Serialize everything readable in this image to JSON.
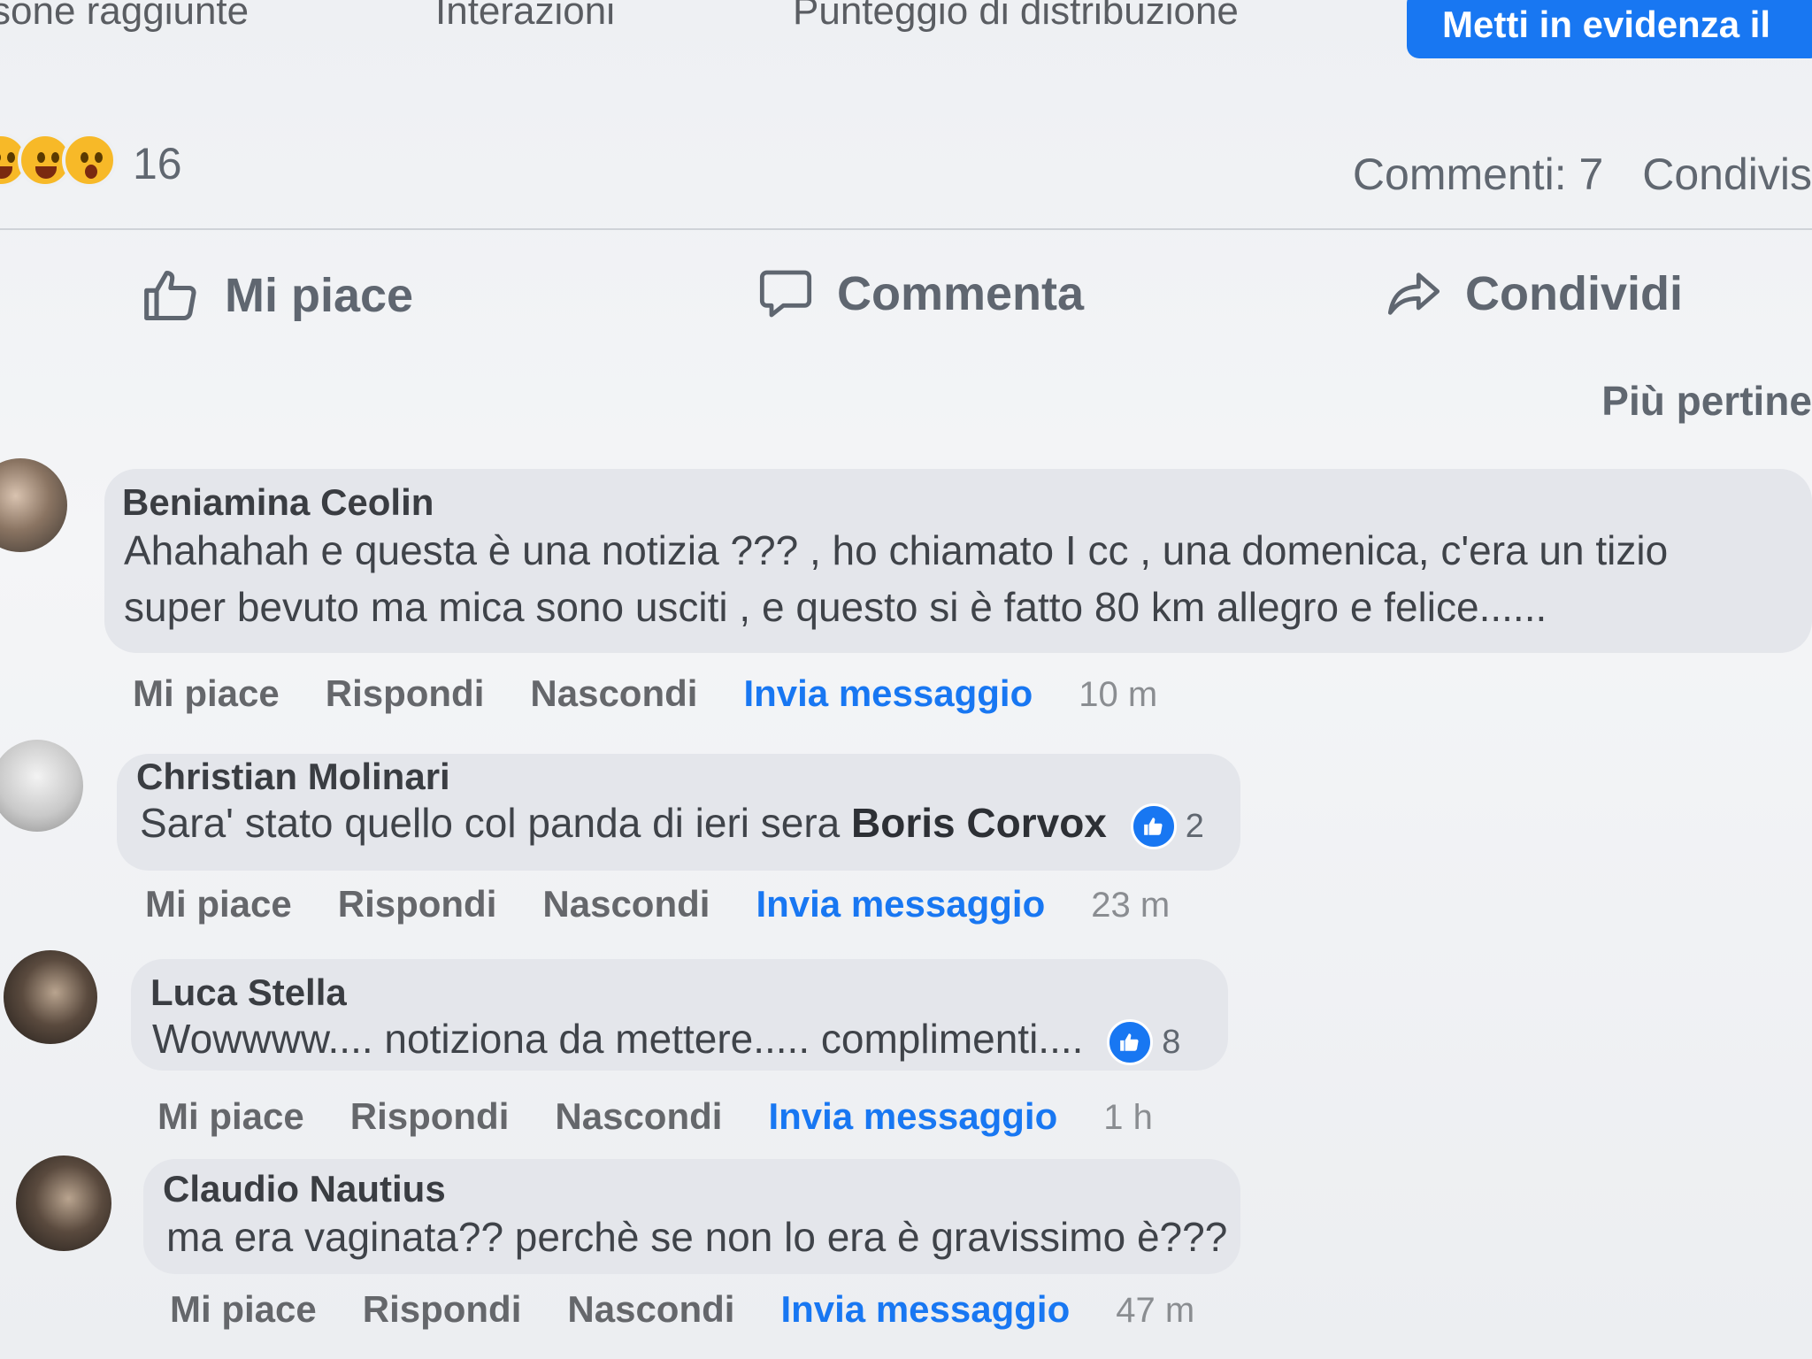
{
  "insights": {
    "reach_label": "sone raggiunte",
    "interactions_label": "Interazioni",
    "distribution_label": "Punteggio di distribuzione",
    "boost_button": "Metti in evidenza il"
  },
  "stats": {
    "reaction_count": "16",
    "comments": "Commenti: 7",
    "shares": "Condivis"
  },
  "actions": {
    "like": "Mi piace",
    "comment": "Commenta",
    "share": "Condividi"
  },
  "sort_label": "Più pertine",
  "comment_actions": {
    "like": "Mi piace",
    "reply": "Rispondi",
    "hide": "Nascondi",
    "message": "Invia messaggio"
  },
  "comments": [
    {
      "author": "Beniamina Ceolin",
      "line1": "Ahahahah e questa è una notizia ??? , ho chiamato I cc , una domenica, c'era un tizio",
      "line2": "super bevuto ma mica sono usciti , e questo si è fatto 80 km allegro e felice......",
      "time": "10 m"
    },
    {
      "author": "Christian Molinari",
      "text": "Sara' stato quello col panda di ieri sera",
      "mention": "Boris Corvox",
      "likes": "2",
      "time": "23 m"
    },
    {
      "author": "Luca Stella",
      "text": "Wowwww.... notiziona da mettere..... complimenti....",
      "likes": "8",
      "time": "1 h"
    },
    {
      "author": "Claudio Nautius",
      "text": "ma era vaginata?? perchè se non lo era è gravissimo è???",
      "time": "47 m"
    }
  ],
  "colors": {
    "accent": "#1877f2",
    "bubble": "#e4e6eb",
    "reaction": "#f7b928"
  }
}
